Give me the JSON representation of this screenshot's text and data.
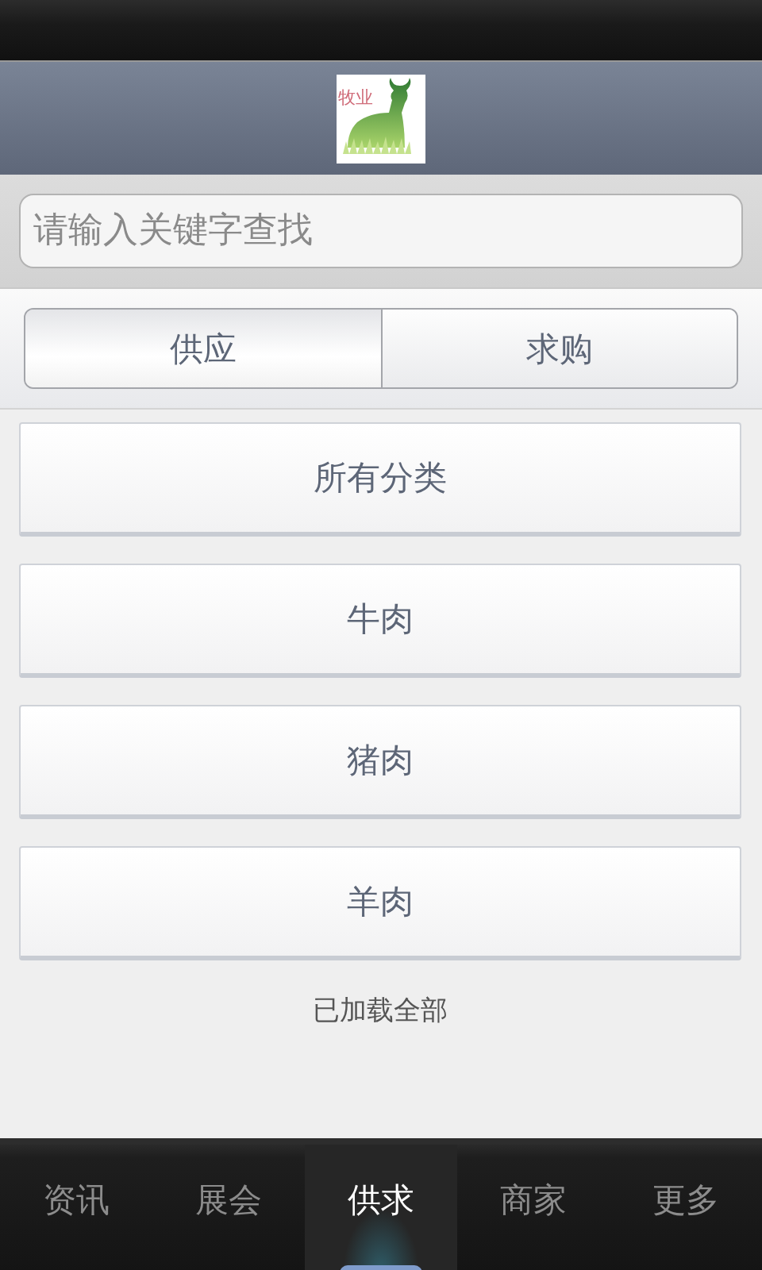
{
  "header": {
    "logo_text": "牧业"
  },
  "search": {
    "placeholder": "请输入关键字查找"
  },
  "segments": [
    {
      "label": "供应",
      "selected": true
    },
    {
      "label": "求购",
      "selected": false
    }
  ],
  "categories": [
    {
      "label": "所有分类"
    },
    {
      "label": "牛肉"
    },
    {
      "label": "猪肉"
    },
    {
      "label": "羊肉"
    }
  ],
  "footer_note": "已加载全部",
  "tabs": [
    {
      "label": "资讯",
      "selected": false
    },
    {
      "label": "展会",
      "selected": false
    },
    {
      "label": "供求",
      "selected": true
    },
    {
      "label": "商家",
      "selected": false
    },
    {
      "label": "更多",
      "selected": false
    }
  ]
}
